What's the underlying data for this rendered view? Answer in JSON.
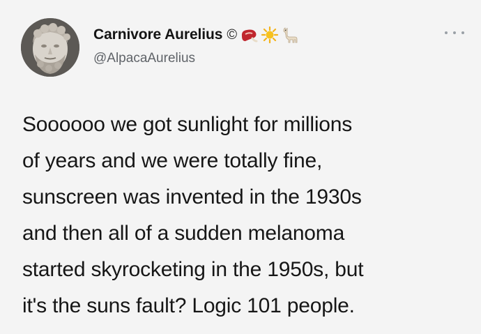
{
  "profile": {
    "display_name": "Carnivore Aurelius",
    "copyright_symbol": "©",
    "handle": "@AlpacaAurelius",
    "avatar_icon": "marcus-aurelius-bust-avatar",
    "name_emojis": [
      "steak-emoji",
      "sun-emoji",
      "llama-emoji"
    ]
  },
  "menu": {
    "more_icon": "more-horizontal-icon"
  },
  "tweet": {
    "lines": [
      "Soooooo we got sunlight for millions",
      "of years and we were totally fine,",
      "sunscreen was invented in the 1930s",
      "and then all of a sudden melanoma",
      "started skyrocketing in the 1950s, but",
      "it's the suns fault? Logic 101 people."
    ]
  },
  "colors": {
    "background": "#f4f4f4",
    "text": "#161616",
    "handle": "#5f6368"
  }
}
